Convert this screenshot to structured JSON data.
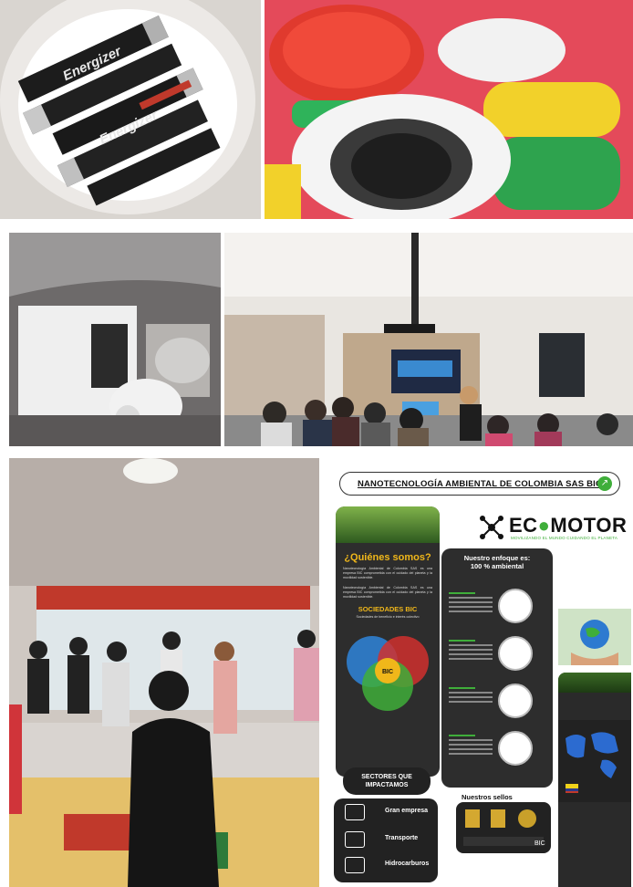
{
  "photos": {
    "batteries": {
      "brand_text": "Energizer",
      "scene": "batteries-in-bowl"
    },
    "bottle_caps": {
      "scene": "plastic-caps"
    },
    "box_bin": {
      "scene": "collection-box"
    },
    "meeting_room": {
      "scene": "presentation"
    },
    "activity_room": {
      "scene": "group-activity"
    }
  },
  "infographic": {
    "header_title": "NANOTECNOLOGÍA AMBIENTAL DE COLOMBIA SAS BIC",
    "logo": {
      "word_left": "EC",
      "word_right": "MOTOR",
      "tagline": "MOVILIZANDO EL MUNDO CUIDANDO EL PLANETA"
    },
    "who": {
      "title": "¿Quiénes somos?",
      "body": "Nanotecnología Ambiental de Colombia SAS es una empresa BIC comprometida con el cuidado del planeta y la movilidad sostenible.",
      "sub_title": "SOCIEDADES BIC",
      "venn_caption": "Sociedades de beneficio e interés colectivo",
      "venn_label": "BIC"
    },
    "focus": {
      "title_line1": "Nuestro enfoque es:",
      "title_line2": "100 % ambiental"
    },
    "sectors": {
      "title": "SECTORES QUE IMPACTAMOS",
      "items": [
        "Gran empresa",
        "Transporte",
        "Hidrocarburos"
      ]
    },
    "seals": {
      "title": "Nuestros sellos",
      "badge": "BIC"
    }
  },
  "colors": {
    "accent_green": "#3fae3a",
    "gold": "#f0b71a",
    "panel_dark": "#2d2d2d"
  }
}
